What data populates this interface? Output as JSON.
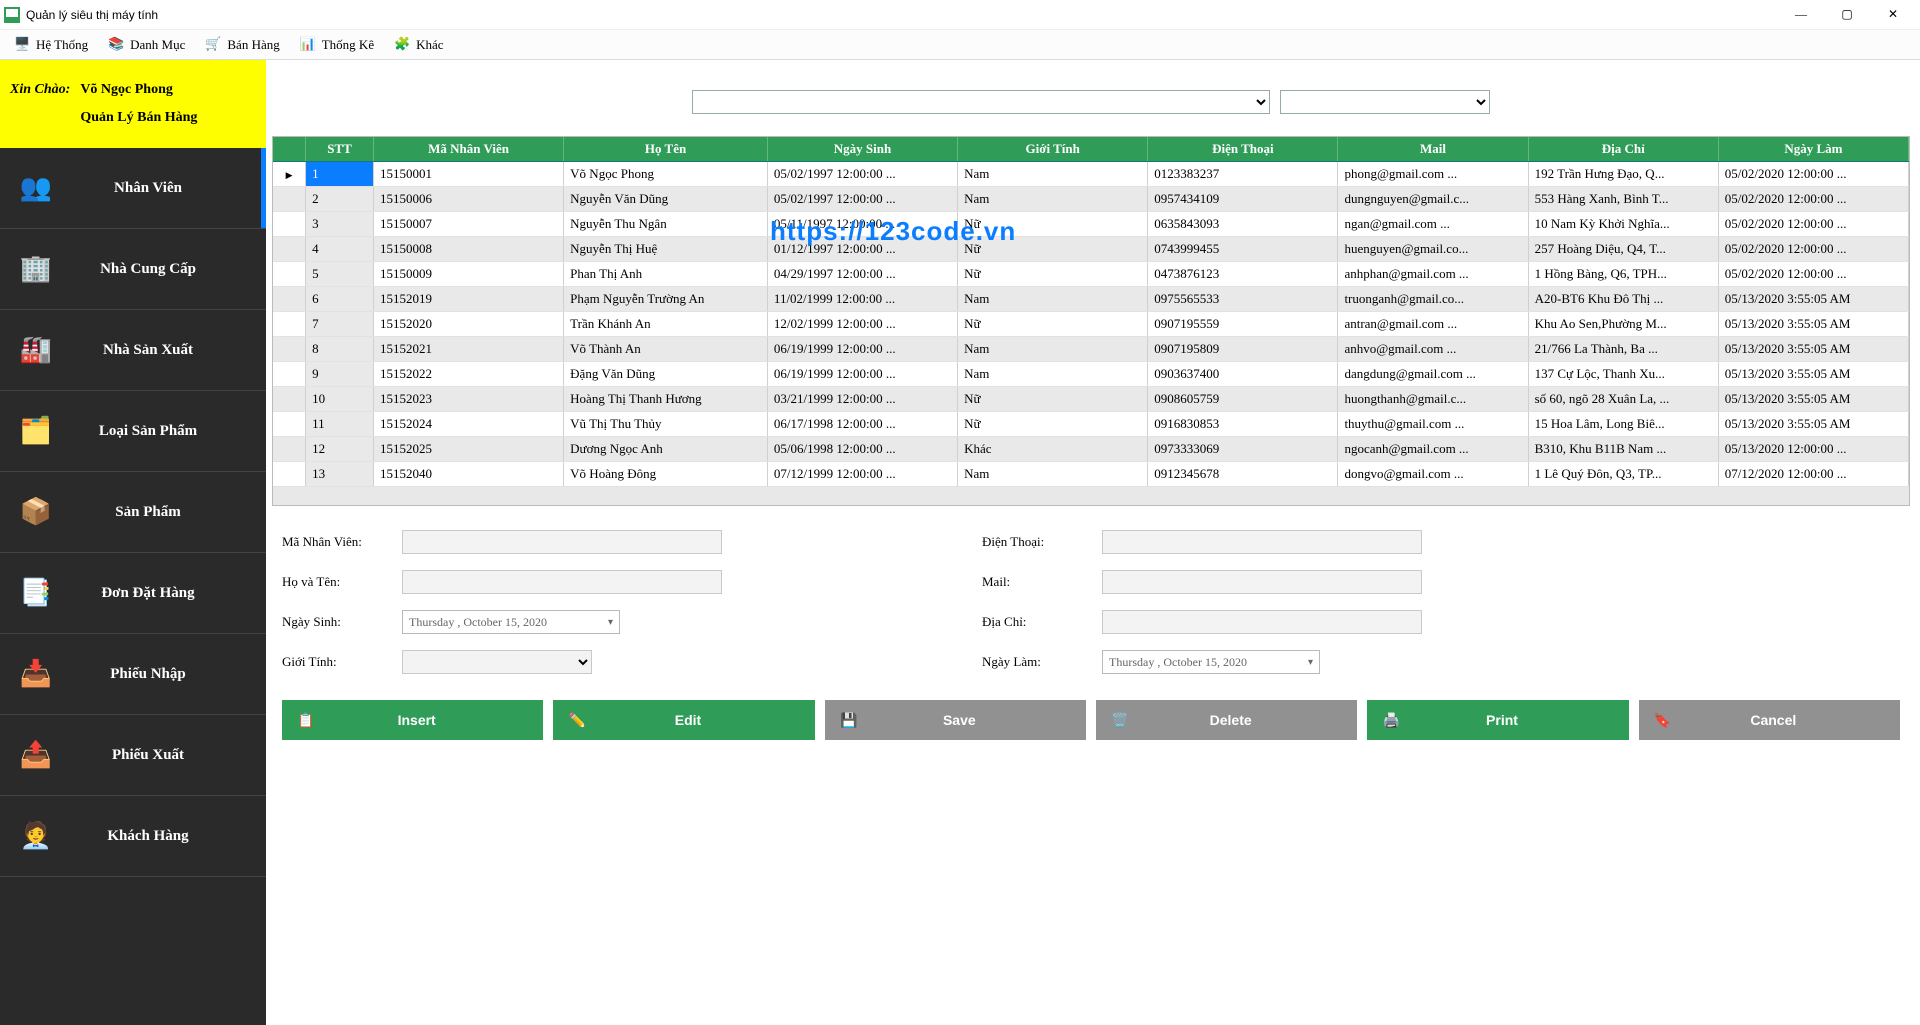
{
  "window": {
    "title": "Quản lý siêu thị máy tính"
  },
  "menubar": [
    {
      "label": "Hệ Thống"
    },
    {
      "label": "Danh Mục"
    },
    {
      "label": "Bán Hàng"
    },
    {
      "label": "Thống Kê"
    },
    {
      "label": "Khác"
    }
  ],
  "greeting": {
    "label": "Xin Chào:",
    "name": "Võ Ngọc Phong",
    "role": "Quản Lý Bán Hàng"
  },
  "sidebar": [
    {
      "label": "Nhân Viên",
      "active": true
    },
    {
      "label": "Nhà Cung Cấp"
    },
    {
      "label": "Nhà Sản Xuất"
    },
    {
      "label": "Loại Sản Phẩm"
    },
    {
      "label": "Sản Phẩm"
    },
    {
      "label": "Đơn Đặt Hàng"
    },
    {
      "label": "Phiếu Nhập"
    },
    {
      "label": "Phiếu Xuất"
    },
    {
      "label": "Khách Hàng"
    }
  ],
  "grid": {
    "headers": [
      "",
      "STT",
      "Mã Nhân Viên",
      "Họ Tên",
      "Ngày Sinh",
      "Giới Tính",
      "Điện Thoại",
      "Mail",
      "Địa Chỉ",
      "Ngày Làm"
    ],
    "rows": [
      [
        "1",
        "15150001",
        "Võ Ngọc Phong",
        "05/02/1997 12:00:00 ...",
        "Nam",
        "0123383237",
        "phong@gmail.com   ...",
        "192 Trần Hưng Đạo, Q...",
        "05/02/2020 12:00:00 ..."
      ],
      [
        "2",
        "15150006",
        "Nguyễn Văn Dũng",
        "05/02/1997 12:00:00 ...",
        "Nam",
        "0957434109",
        "dungnguyen@gmail.c...",
        "553 Hàng Xanh, Bình T...",
        "05/02/2020 12:00:00 ..."
      ],
      [
        "3",
        "15150007",
        "Nguyễn Thu Ngân",
        "05/11/1997 12:00:00 ...",
        "Nữ",
        "0635843093",
        "ngan@gmail.com     ...",
        "10 Nam Kỳ Khởi Nghĩa...",
        "05/02/2020 12:00:00 ..."
      ],
      [
        "4",
        "15150008",
        "Nguyễn Thị Huệ",
        "01/12/1997 12:00:00 ...",
        "Nữ",
        "0743999455",
        "huenguyen@gmail.co...",
        "257 Hoàng Diệu, Q4, T...",
        "05/02/2020 12:00:00 ..."
      ],
      [
        "5",
        "15150009",
        "Phan Thị Anh",
        "04/29/1997 12:00:00 ...",
        "Nữ",
        "0473876123",
        "anhphan@gmail.com ...",
        "1 Hồng Bàng, Q6, TPH...",
        "05/02/2020 12:00:00 ..."
      ],
      [
        "6",
        "15152019",
        "Phạm Nguyễn Trường An",
        "11/02/1999 12:00:00 ...",
        "Nam",
        "0975565533",
        "truonganh@gmail.co...",
        "A20-BT6 Khu Đô Thị ...",
        "05/13/2020 3:55:05 AM"
      ],
      [
        "7",
        "15152020",
        "Trần Khánh An",
        "12/02/1999 12:00:00 ...",
        "Nữ",
        "0907195559",
        "antran@gmail.com   ...",
        "Khu Ao Sen,Phường M...",
        "05/13/2020 3:55:05 AM"
      ],
      [
        "8",
        "15152021",
        "Võ Thành An",
        "06/19/1999 12:00:00 ...",
        "Nam",
        "0907195809",
        "anhvo@gmail.com    ...",
        "21/766 La Thành, Ba ...",
        "05/13/2020 3:55:05 AM"
      ],
      [
        "9",
        "15152022",
        "Đặng Văn Dũng",
        "06/19/1999 12:00:00 ...",
        "Nam",
        "0903637400",
        "dangdung@gmail.com ...",
        "137 Cự Lộc, Thanh Xu...",
        "05/13/2020 3:55:05 AM"
      ],
      [
        "10",
        "15152023",
        "Hoàng Thị Thanh Hương",
        "03/21/1999 12:00:00 ...",
        "Nữ",
        "0908605759",
        "huongthanh@gmail.c...",
        "số 60, ngõ 28 Xuân La, ...",
        "05/13/2020 3:55:05 AM"
      ],
      [
        "11",
        "15152024",
        "Vũ Thị Thu Thủy",
        "06/17/1998 12:00:00 ...",
        "Nữ",
        "0916830853",
        "thuythu@gmail.com  ...",
        "15 Hoa Lâm, Long Biê...",
        "05/13/2020 3:55:05 AM"
      ],
      [
        "12",
        "15152025",
        "Dương Ngọc Anh",
        "05/06/1998 12:00:00 ...",
        "Khác",
        "0973333069",
        "ngocanh@gmail.com  ...",
        "B310, Khu B11B Nam ...",
        "05/13/2020 12:00:00 ..."
      ],
      [
        "13",
        "15152040",
        "Võ Hoàng Đông",
        "07/12/1999 12:00:00 ...",
        "Nam",
        "0912345678",
        "dongvo@gmail.com   ...",
        "1 Lê Quý Đôn, Q3, TP...",
        "07/12/2020 12:00:00 ..."
      ]
    ]
  },
  "form": {
    "left": [
      {
        "label": "Mã Nhân Viên:",
        "type": "text"
      },
      {
        "label": "Họ và Tên:",
        "type": "text"
      },
      {
        "label": "Ngày Sinh:",
        "type": "date",
        "value": "Thursday ,   October   15, 2020"
      },
      {
        "label": "Giới Tính:",
        "type": "combo"
      }
    ],
    "right": [
      {
        "label": "Điện Thoại:",
        "type": "text"
      },
      {
        "label": "Mail:",
        "type": "text"
      },
      {
        "label": "Địa Chỉ:",
        "type": "text"
      },
      {
        "label": "Ngày Làm:",
        "type": "date",
        "value": "Thursday ,   October   15, 2020"
      }
    ]
  },
  "actions": [
    {
      "label": "Insert",
      "style": "green"
    },
    {
      "label": "Edit",
      "style": "green"
    },
    {
      "label": "Save",
      "style": "gray"
    },
    {
      "label": "Delete",
      "style": "gray"
    },
    {
      "label": "Print",
      "style": "green"
    },
    {
      "label": "Cancel",
      "style": "gray"
    }
  ],
  "watermark": "https://123code.vn"
}
